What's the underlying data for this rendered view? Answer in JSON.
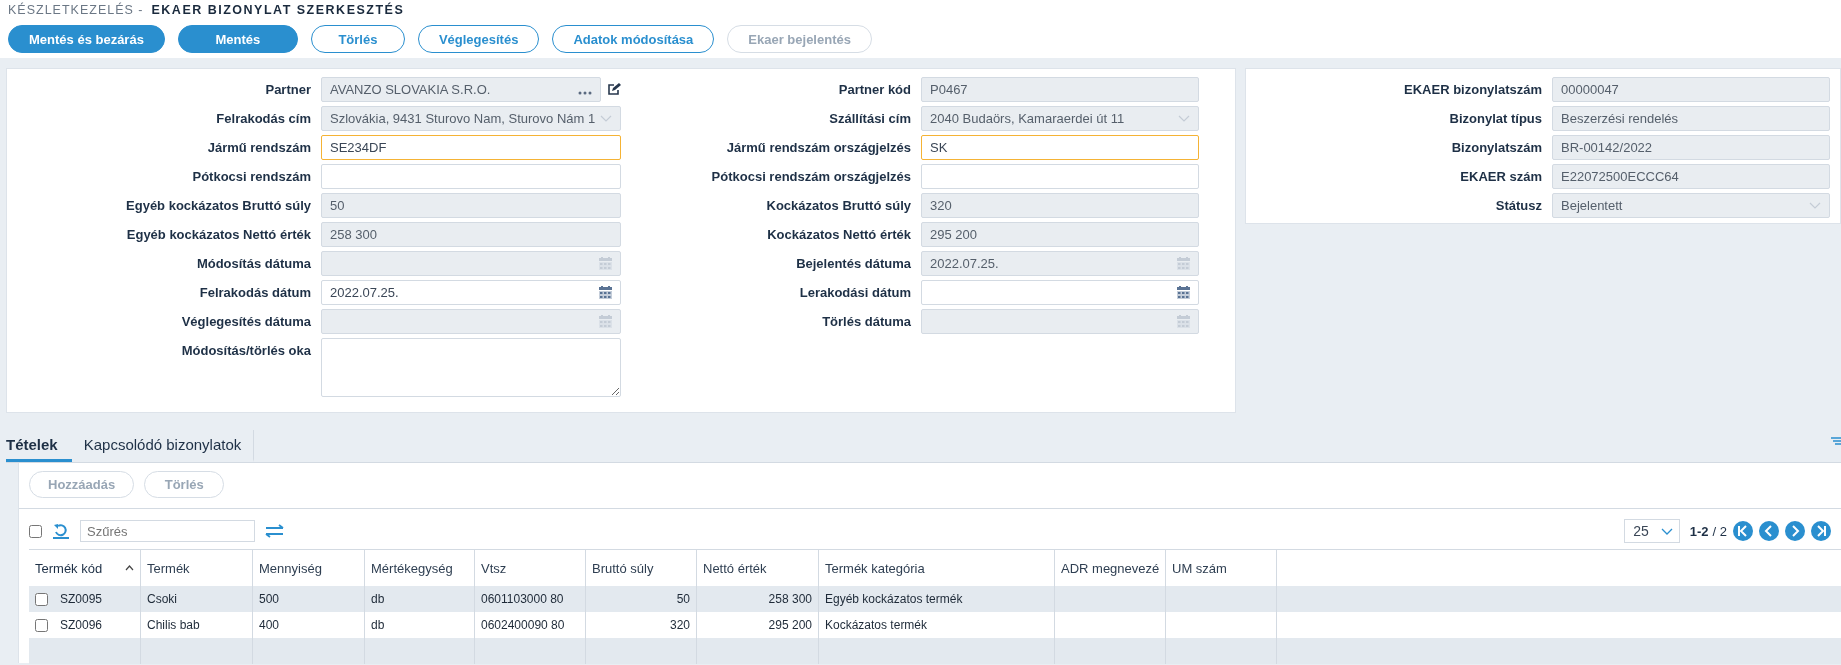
{
  "header": {
    "breadcrumb": "KÉSZLETKEZELÉS -",
    "title": "EKAER BIZONYLAT SZERKESZTÉS"
  },
  "toolbar": [
    {
      "label": "Mentés és bezárás",
      "kind": "primary",
      "disabled": false
    },
    {
      "label": "Mentés",
      "kind": "primary",
      "disabled": false
    },
    {
      "label": "Törlés",
      "kind": "outline",
      "disabled": false
    },
    {
      "label": "Véglegesítés",
      "kind": "outline",
      "disabled": false
    },
    {
      "label": "Adatok módosítása",
      "kind": "outline",
      "disabled": false
    },
    {
      "label": "Ekaer bejelentés",
      "kind": "outline",
      "disabled": true
    }
  ],
  "form_left": [
    {
      "label": "Partner",
      "kind": "lookup",
      "value": "AVANZO SLOVAKIA S.R.O.",
      "disabled": true,
      "required": false
    },
    {
      "label": "Felrakodás cím",
      "kind": "select",
      "value": "Szlovákia, 9431 Sturovo Nam, Sturovo Nám 1",
      "disabled": true,
      "required": false
    },
    {
      "label": "Jármű rendszám",
      "kind": "text",
      "value": "SE234DF",
      "disabled": false,
      "required": true
    },
    {
      "label": "Pótkocsi rendszám",
      "kind": "text",
      "disabled": false,
      "required": false
    },
    {
      "label": "Egyéb kockázatos Bruttó súly",
      "kind": "text",
      "value": "50",
      "disabled": true,
      "required": false
    },
    {
      "label": "Egyéb kockázatos Nettó érték",
      "kind": "text",
      "value": "258 300",
      "disabled": true,
      "required": false
    },
    {
      "label": "Módosítás dátuma",
      "kind": "date",
      "disabled": true,
      "required": false
    },
    {
      "label": "Felrakodás dátum",
      "kind": "date",
      "value": "2022.07.25.",
      "disabled": false,
      "required": false
    },
    {
      "label": "Véglegesítés dátuma",
      "kind": "date",
      "disabled": true,
      "required": false
    },
    {
      "label": "Módosítás/törlés oka",
      "kind": "textarea",
      "disabled": false,
      "required": false
    }
  ],
  "form_middle": [
    {
      "label": "Partner kód",
      "kind": "text",
      "value": "P0467",
      "disabled": true,
      "required": false
    },
    {
      "label": "Szállítási cím",
      "kind": "select",
      "value": "2040 Budaörs, Kamaraerdei út 11",
      "disabled": true,
      "required": false
    },
    {
      "label": "Jármű rendszám országjelzés",
      "kind": "text",
      "value": "SK",
      "disabled": false,
      "required": true
    },
    {
      "label": "Pótkocsi rendszám országjelzés",
      "kind": "text",
      "disabled": false,
      "required": false
    },
    {
      "label": "Kockázatos Bruttó súly",
      "kind": "text",
      "value": "320",
      "disabled": true,
      "required": false
    },
    {
      "label": "Kockázatos Nettó érték",
      "kind": "text",
      "value": "295 200",
      "disabled": true,
      "required": false
    },
    {
      "label": "Bejelentés dátuma",
      "kind": "date",
      "value": "2022.07.25.",
      "disabled": true,
      "required": false
    },
    {
      "label": "Lerakodási dátum",
      "kind": "date",
      "disabled": false,
      "required": false
    },
    {
      "label": "Törlés dátuma",
      "kind": "date",
      "disabled": true,
      "required": false
    }
  ],
  "form_right": [
    {
      "label": "EKAER bizonylatszám",
      "kind": "text",
      "value": "00000047",
      "disabled": true,
      "required": false
    },
    {
      "label": "Bizonylat típus",
      "kind": "text",
      "value": "Beszerzési rendelés",
      "disabled": true,
      "required": false
    },
    {
      "label": "Bizonylatszám",
      "kind": "text",
      "value": "BR-00142/2022",
      "disabled": true,
      "required": false
    },
    {
      "label": "EKAER szám",
      "kind": "text",
      "value": "E22072500ECCC64",
      "disabled": true,
      "required": false
    },
    {
      "label": "Státusz",
      "kind": "select",
      "value": "Bejelentett",
      "disabled": true,
      "required": false
    }
  ],
  "tabs": [
    {
      "label": "Tételek",
      "selected": true
    },
    {
      "label": "Kapcsolódó bizonylatok",
      "selected": false
    }
  ],
  "items_toolbar": [
    {
      "label": "Hozzáadás",
      "disabled": true
    },
    {
      "label": "Törlés",
      "disabled": true
    }
  ],
  "filter": {
    "placeholder": "Szűrés",
    "select_all_checked": false
  },
  "pagination": {
    "page_size": "25",
    "range": "1-2",
    "total": "/ 2"
  },
  "table": {
    "columns": [
      {
        "label": "Termék kód",
        "sorted": true,
        "kind": "text"
      },
      {
        "label": "Termék",
        "sorted": false,
        "kind": "text"
      },
      {
        "label": "Mennyiség",
        "sorted": false,
        "kind": "text"
      },
      {
        "label": "Mértékegység",
        "sorted": false,
        "kind": "text"
      },
      {
        "label": "Vtsz",
        "sorted": false,
        "kind": "text"
      },
      {
        "label": "Bruttó súly",
        "sorted": false,
        "kind": "number"
      },
      {
        "label": "Nettó érték",
        "sorted": false,
        "kind": "number"
      },
      {
        "label": "Termék kategória",
        "sorted": false,
        "kind": "text"
      },
      {
        "label": "ADR megnevezé",
        "sorted": false,
        "kind": "text"
      },
      {
        "label": "UM szám",
        "sorted": false,
        "kind": "text"
      }
    ],
    "rows": [
      {
        "checked": false,
        "cells": [
          "SZ0095",
          "Csoki",
          "500",
          "db",
          "0601103000 80",
          "50",
          "258 300",
          "Egyéb kockázatos termék",
          "",
          ""
        ]
      },
      {
        "checked": false,
        "cells": [
          "SZ0096",
          "Chilis bab",
          "400",
          "db",
          "0602400090 80",
          "320",
          "295 200",
          "Kockázatos termék",
          "",
          ""
        ]
      }
    ]
  }
}
